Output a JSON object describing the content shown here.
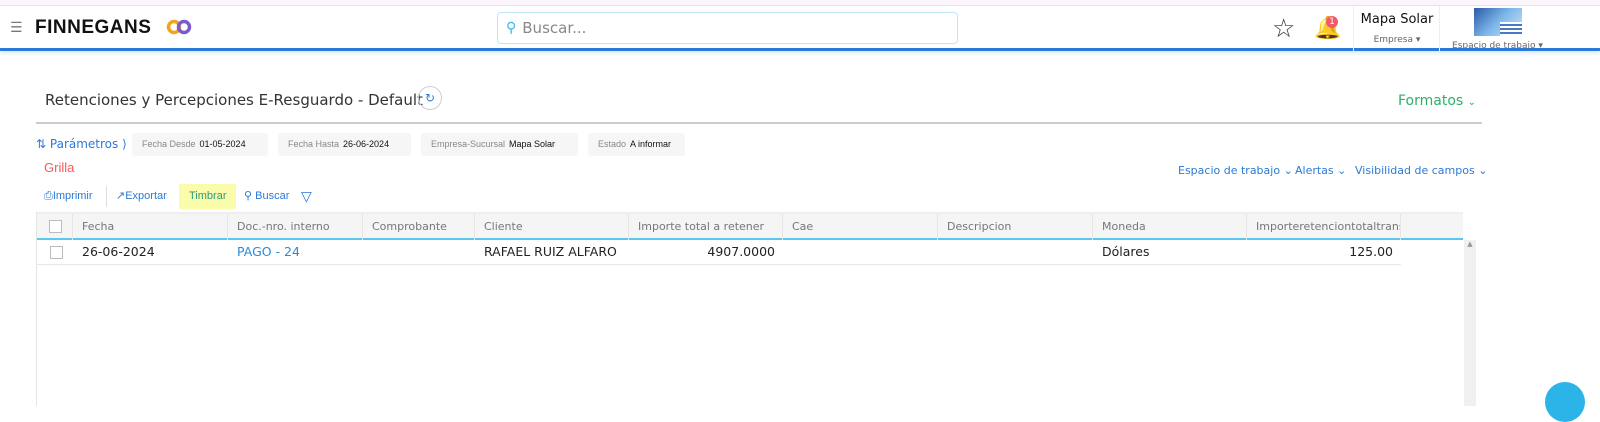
{
  "header": {
    "brand": "FINNEGANS",
    "search_placeholder": "Buscar...",
    "notifications": "1",
    "company_name": "Mapa Solar",
    "company_label": "Empresa",
    "workspace_label": "Espacio de trabajo"
  },
  "page": {
    "title": "Retenciones y Percepciones E-Resguardo - Default",
    "formatos": "Formatos"
  },
  "params": {
    "label": "Parámetros",
    "filters": [
      {
        "k": "Fecha Desde",
        "v": "01-05-2024"
      },
      {
        "k": "Fecha Hasta",
        "v": "26-06-2024"
      },
      {
        "k": "Empresa-Sucursal",
        "v": "Mapa Solar"
      },
      {
        "k": "Estado",
        "v": "A informar"
      }
    ]
  },
  "section": "Grilla",
  "toolbar": {
    "print": "Imprimir",
    "export": "Exportar",
    "stamp": "Timbrar",
    "search": "Buscar"
  },
  "right_links": [
    "Espacio de trabajo",
    "Alertas",
    "Visibilidad de campos"
  ],
  "table": {
    "columns": [
      "Fecha",
      "Doc.-nro. interno",
      "Comprobante",
      "Cliente",
      "Importe total a retener",
      "Cae",
      "Descripcion",
      "Moneda",
      "Importeretenciontotaltransac"
    ],
    "rows": [
      {
        "fecha": "26-06-2024",
        "doc": "PAGO - 24",
        "comprobante": "",
        "cliente": "RAFAEL RUIZ ALFARO",
        "importe": "4907.0000",
        "cae": "",
        "descripcion": "",
        "moneda": "Dólares",
        "importe_ret": "125.00"
      }
    ]
  }
}
